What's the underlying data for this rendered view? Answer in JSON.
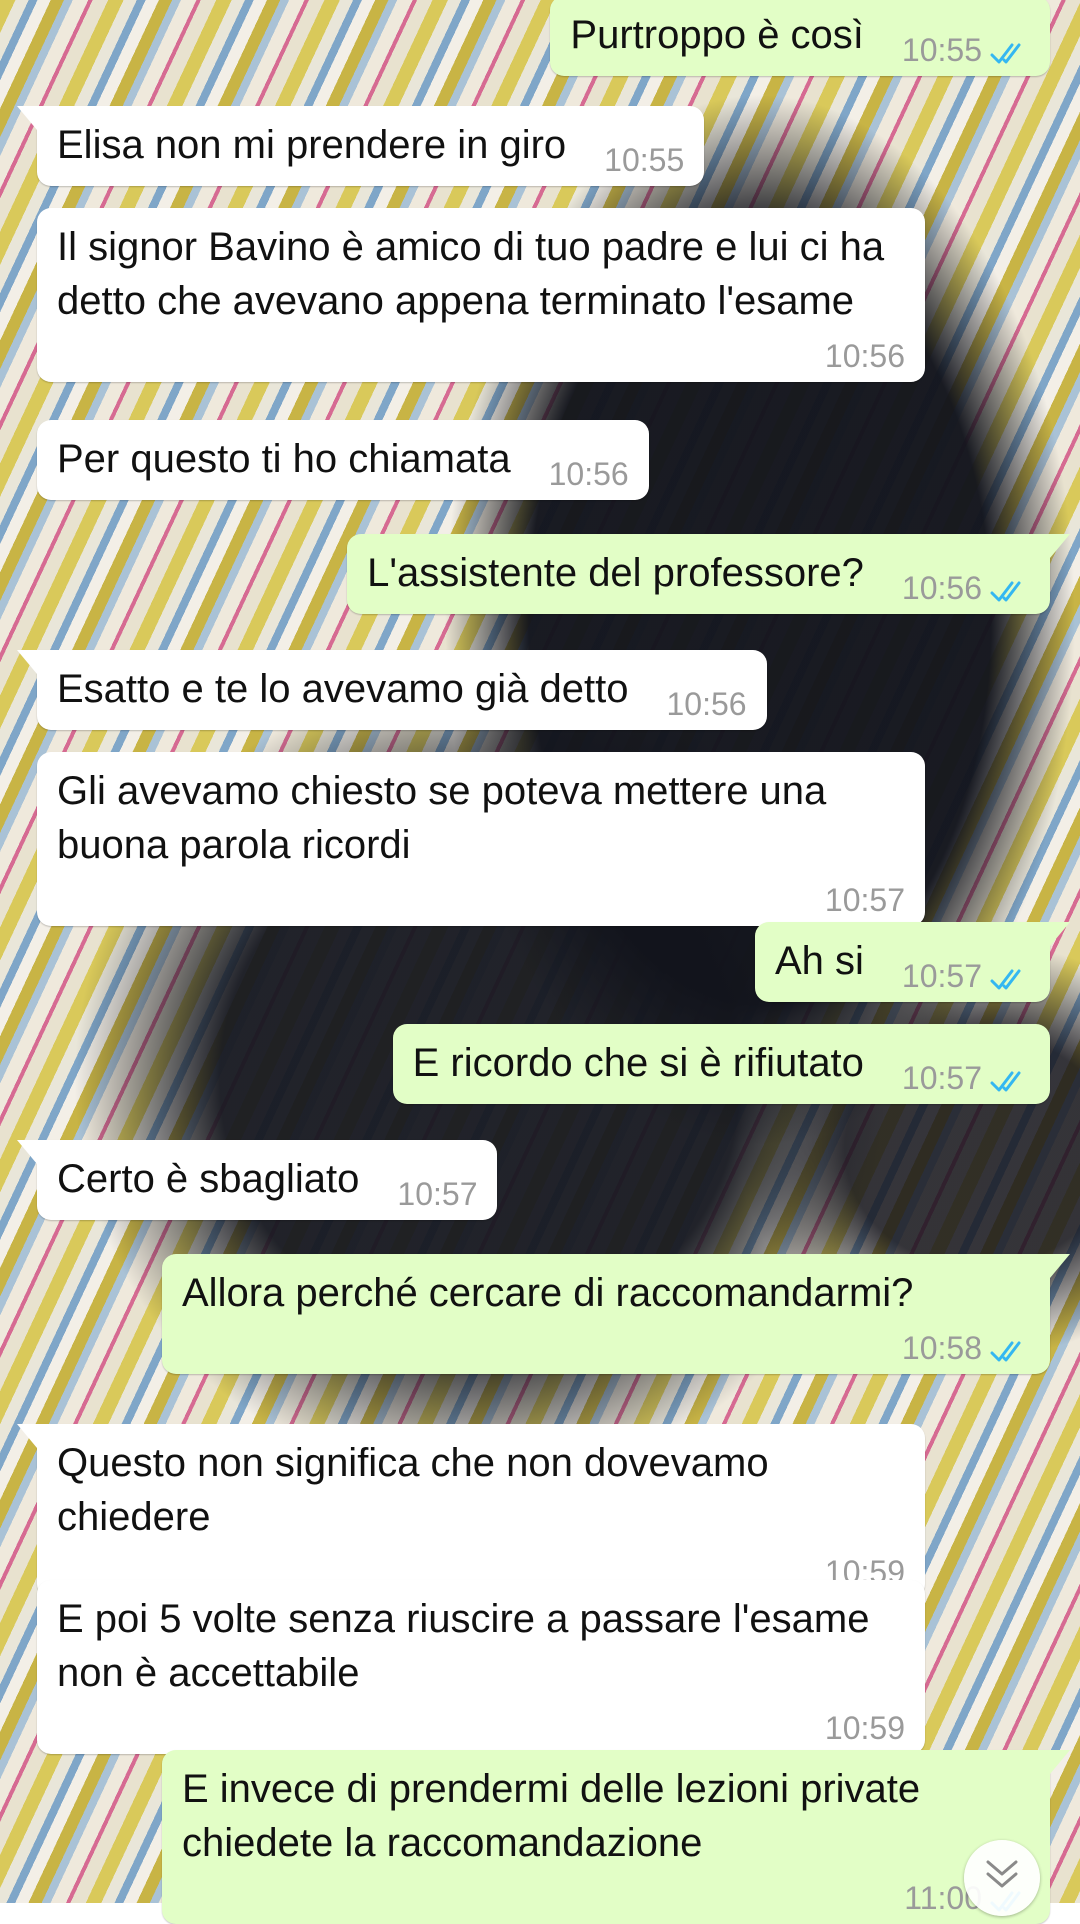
{
  "messages": [
    {
      "dir": "out",
      "text": "Purtroppo è così",
      "time": "10:55",
      "read": true
    },
    {
      "dir": "in",
      "text": "Elisa non mi prendere in giro",
      "time": "10:55"
    },
    {
      "dir": "in",
      "text": "Il signor Bavino è amico di tuo padre e lui ci ha detto che avevano appena terminato l'esame",
      "time": "10:56"
    },
    {
      "dir": "in",
      "text": "Per questo ti ho chiamata",
      "time": "10:56"
    },
    {
      "dir": "out",
      "text": "L'assistente del professore?",
      "time": "10:56",
      "read": true
    },
    {
      "dir": "in",
      "text": "Esatto e te lo avevamo già detto",
      "time": "10:56"
    },
    {
      "dir": "in",
      "text": "Gli avevamo chiesto se poteva mettere una buona parola ricordi",
      "time": "10:57"
    },
    {
      "dir": "out",
      "text": "Ah si",
      "time": "10:57",
      "read": true
    },
    {
      "dir": "out",
      "text": "E ricordo che si è rifiutato",
      "time": "10:57",
      "read": true
    },
    {
      "dir": "in",
      "text": "Certo è sbagliato",
      "time": "10:57"
    },
    {
      "dir": "out",
      "text": "Allora perché cercare di raccomandarmi?",
      "time": "10:58",
      "read": true
    },
    {
      "dir": "in",
      "text": "Questo non significa che non dovevamo chiedere",
      "time": "10:59"
    },
    {
      "dir": "in",
      "text": "E poi 5 volte senza riuscire a passare l'esame non è accettabile",
      "time": "10:59"
    },
    {
      "dir": "out",
      "text": "E invece di prendermi delle lezioni private chiedete la raccomandazione",
      "time": "11:00",
      "read": true
    }
  ],
  "icons": {
    "read_ticks": "double-check-icon",
    "scroll_down": "chevron-double-down-icon"
  },
  "colors": {
    "incoming_bubble": "#ffffff",
    "outgoing_bubble": "#e2fec6",
    "read_ticks": "#34b7f1",
    "meta_text": "#9a9a9a"
  }
}
